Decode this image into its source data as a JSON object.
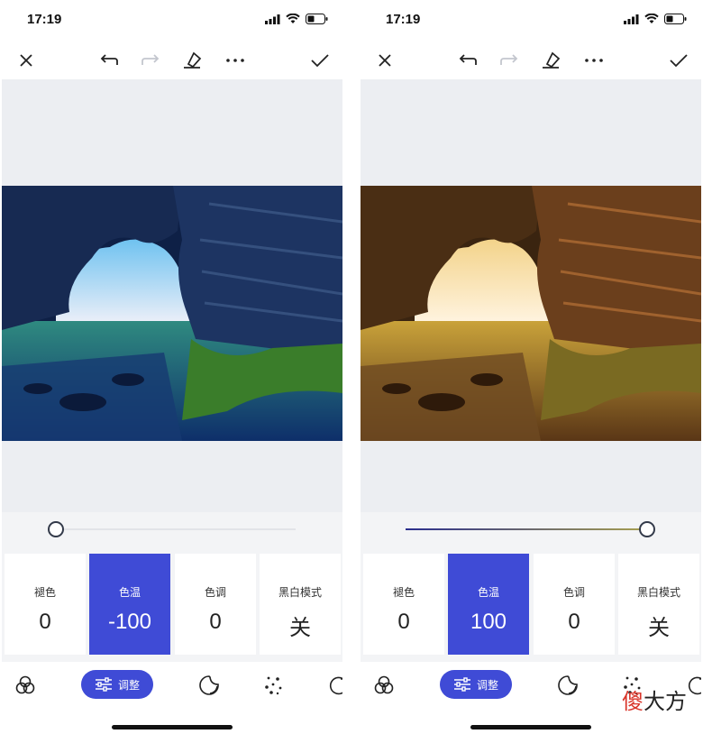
{
  "panels": [
    {
      "status": {
        "time": "17:19"
      },
      "slider": {
        "value": -100
      },
      "cards": [
        {
          "label": "褪色",
          "value": "0"
        },
        {
          "label": "色温",
          "value": "-100"
        },
        {
          "label": "色调",
          "value": "0"
        },
        {
          "label": "黑白模式",
          "value": "关"
        }
      ],
      "active_card": "色温",
      "tint": "cool",
      "bottom_bar": {
        "adjust_label": "调整"
      }
    },
    {
      "status": {
        "time": "17:19"
      },
      "slider": {
        "value": 100
      },
      "cards": [
        {
          "label": "褪色",
          "value": "0"
        },
        {
          "label": "色温",
          "value": "100"
        },
        {
          "label": "色调",
          "value": "0"
        },
        {
          "label": "黑白模式",
          "value": "关"
        }
      ],
      "active_card": "色温",
      "tint": "warm",
      "bottom_bar": {
        "adjust_label": "调整"
      }
    }
  ],
  "toolbar_icons": [
    "close-icon",
    "undo-icon",
    "redo-icon",
    "eraser-icon",
    "more-icon",
    "check-icon"
  ],
  "bottom_icons": [
    "filters-icon",
    "adjust-icon",
    "sticker-icon",
    "dots-icon",
    "rotate-icon"
  ],
  "watermark": {
    "first": "傻",
    "rest": "大方"
  },
  "colors": {
    "accent": "#3f4bd6",
    "canvas": "#eceef2",
    "panel_bg": "#f3f4f6"
  }
}
